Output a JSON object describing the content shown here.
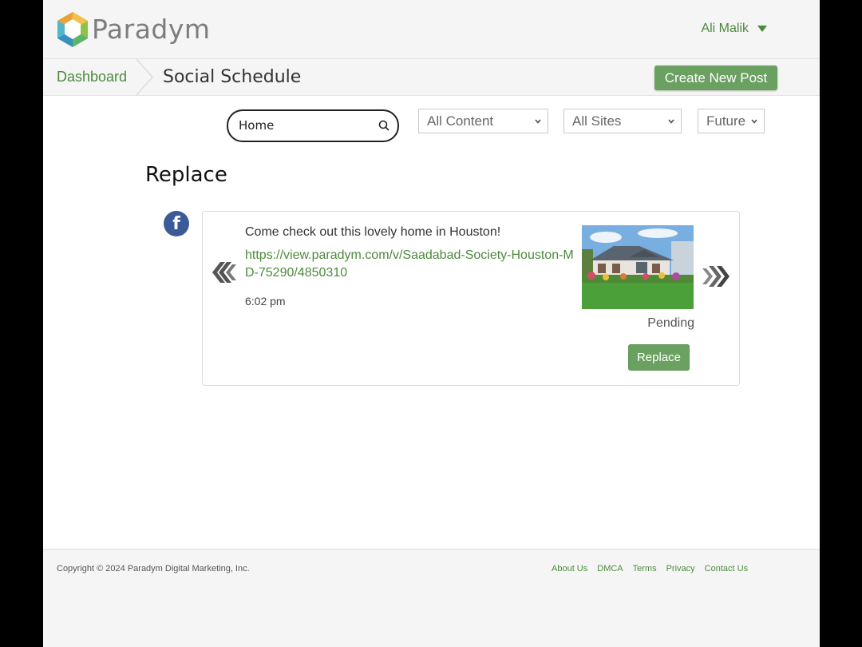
{
  "brand": {
    "name": "Paradym"
  },
  "user": {
    "name": "Ali Malik"
  },
  "breadcrumb": {
    "dashboard": "Dashboard",
    "current": "Social Schedule"
  },
  "actions": {
    "create_post": "Create New Post"
  },
  "filters": {
    "search_value": "Home",
    "content": "All Content",
    "sites": "All Sites",
    "time": "Future"
  },
  "section": {
    "title": "Replace"
  },
  "post": {
    "network_icon": "facebook-icon",
    "message": "Come check out this lovely home in Houston!",
    "link": "https://view.paradym.com/v/Saadabad-Society-Houston-MD-75290/4850310",
    "time": "6:02 pm",
    "status": "Pending",
    "replace_label": "Replace"
  },
  "footer": {
    "copyright": "Copyright © 2024 Paradym Digital Marketing, Inc.",
    "links": [
      "About Us",
      "DMCA",
      "Terms",
      "Privacy",
      "Contact Us"
    ]
  },
  "colors": {
    "accent": "#4c8a3c",
    "button": "#6aa060",
    "facebook": "#3b5a98"
  }
}
